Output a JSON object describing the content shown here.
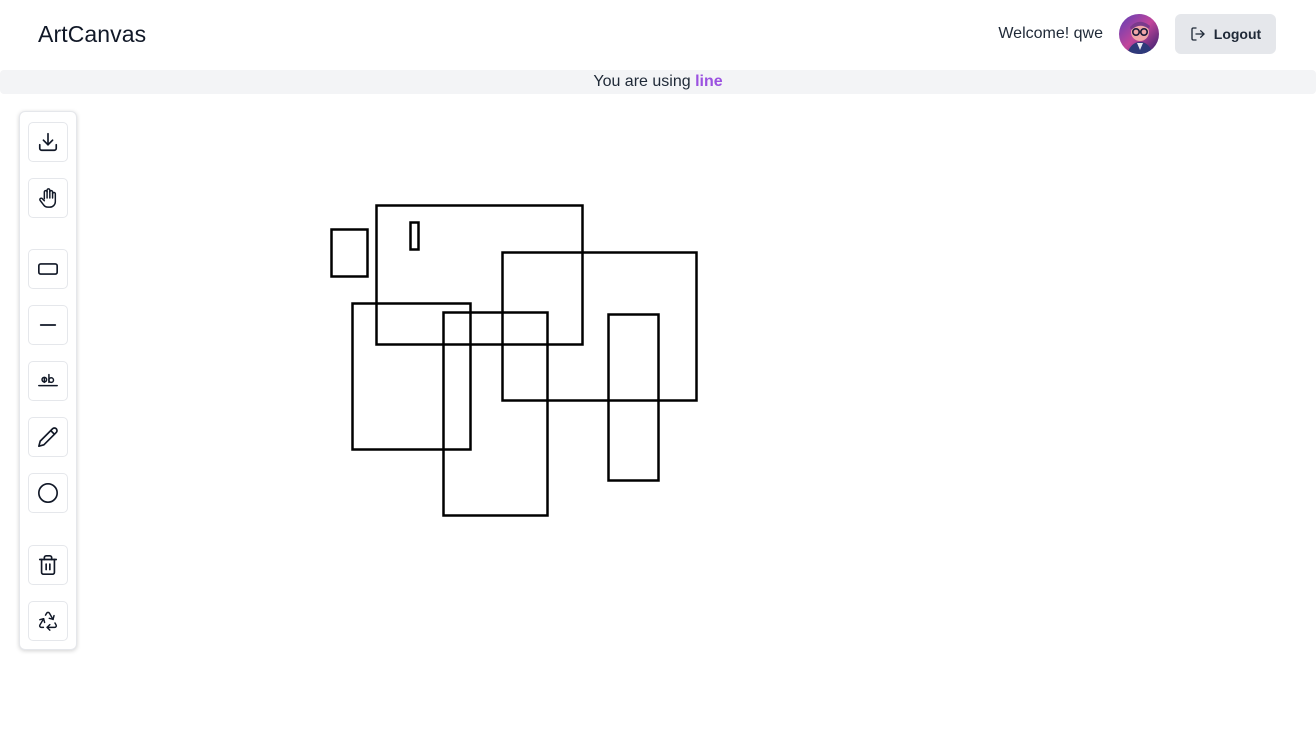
{
  "header": {
    "brand": "ArtCanvas",
    "welcome": "Welcome! qwe",
    "logout_label": "Logout"
  },
  "status": {
    "prefix": "You are using ",
    "tool": "line"
  },
  "toolbar": {
    "tools": [
      {
        "name": "download",
        "icon": "download-icon"
      },
      {
        "name": "pan",
        "icon": "hand-icon"
      },
      {
        "name": "rectangle",
        "icon": "rectangle-icon"
      },
      {
        "name": "line",
        "icon": "line-icon"
      },
      {
        "name": "text",
        "icon": "text-icon"
      },
      {
        "name": "pencil",
        "icon": "pencil-icon"
      },
      {
        "name": "circle",
        "icon": "circle-icon"
      },
      {
        "name": "delete",
        "icon": "trash-icon"
      },
      {
        "name": "recycle",
        "icon": "recycle-icon"
      }
    ]
  },
  "colors": {
    "accent": "#9b51e0",
    "status_bg": "#f3f4f6",
    "button_bg": "#e5e7eb",
    "stroke": "#000000"
  }
}
